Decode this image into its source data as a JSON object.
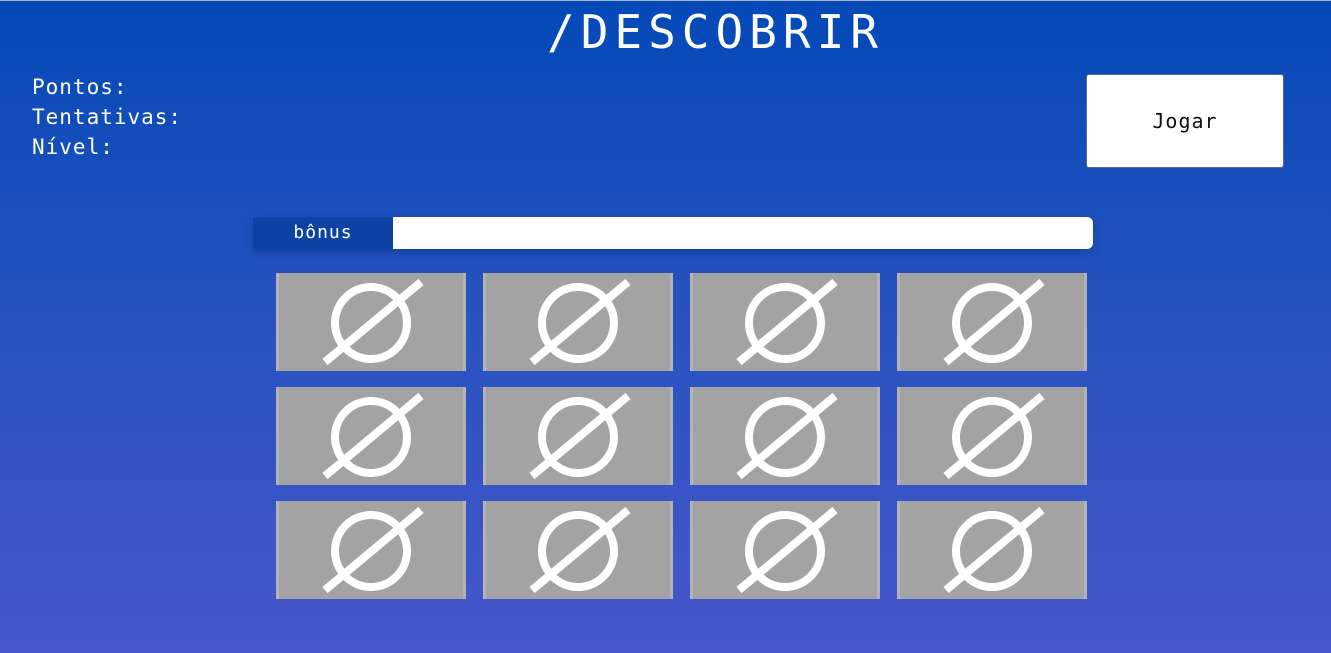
{
  "header": {
    "title": "/DESCOBRIR"
  },
  "stats": {
    "points_label": "Pontos:",
    "attempts_label": "Tentativas:",
    "level_label": "Nível:"
  },
  "controls": {
    "play_label": "Jogar"
  },
  "bonus": {
    "label": "bônus",
    "progress": 0
  },
  "board": {
    "rows": 3,
    "columns": 4,
    "cards": [
      {
        "state": "hidden",
        "icon": "empty-set-icon"
      },
      {
        "state": "hidden",
        "icon": "empty-set-icon"
      },
      {
        "state": "hidden",
        "icon": "empty-set-icon"
      },
      {
        "state": "hidden",
        "icon": "empty-set-icon"
      },
      {
        "state": "hidden",
        "icon": "empty-set-icon"
      },
      {
        "state": "hidden",
        "icon": "empty-set-icon"
      },
      {
        "state": "hidden",
        "icon": "empty-set-icon"
      },
      {
        "state": "hidden",
        "icon": "empty-set-icon"
      },
      {
        "state": "hidden",
        "icon": "empty-set-icon"
      },
      {
        "state": "hidden",
        "icon": "empty-set-icon"
      },
      {
        "state": "hidden",
        "icon": "empty-set-icon"
      },
      {
        "state": "hidden",
        "icon": "empty-set-icon"
      }
    ]
  },
  "colors": {
    "background_top": "#0349b7",
    "background_bottom": "#4657cb",
    "bonus_label_bg": "#0c43a5",
    "card_bg": "#a3a3a3",
    "icon": "#ffffff"
  }
}
